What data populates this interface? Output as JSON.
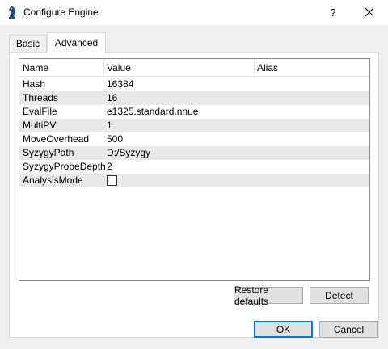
{
  "window": {
    "title": "Configure Engine",
    "help_label": "?",
    "icon": "chess-knight-icon"
  },
  "tabs": [
    {
      "label": "Basic",
      "active": false
    },
    {
      "label": "Advanced",
      "active": true
    }
  ],
  "table": {
    "headers": [
      "Name",
      "Value",
      "Alias"
    ],
    "rows": [
      {
        "name": "Hash",
        "value": "16384",
        "alias": ""
      },
      {
        "name": "Threads",
        "value": "16",
        "alias": ""
      },
      {
        "name": "EvalFile",
        "value": "e1325.standard.nnue",
        "alias": ""
      },
      {
        "name": "MultiPV",
        "value": "1",
        "alias": ""
      },
      {
        "name": "MoveOverhead",
        "value": "500",
        "alias": ""
      },
      {
        "name": "SyzygyPath",
        "value": "D:/Syzygy",
        "alias": ""
      },
      {
        "name": "SyzygyProbeDepth",
        "value": "2",
        "alias": ""
      },
      {
        "name": "AnalysisMode",
        "value": "",
        "alias": "",
        "checkbox": false
      }
    ]
  },
  "buttons": {
    "restore_defaults": "Restore defaults",
    "detect": "Detect",
    "ok": "OK",
    "cancel": "Cancel"
  },
  "colors": {
    "accent": "#0078d7",
    "row_alt": "#e8e8e8",
    "button_face": "#e1e1e1"
  }
}
